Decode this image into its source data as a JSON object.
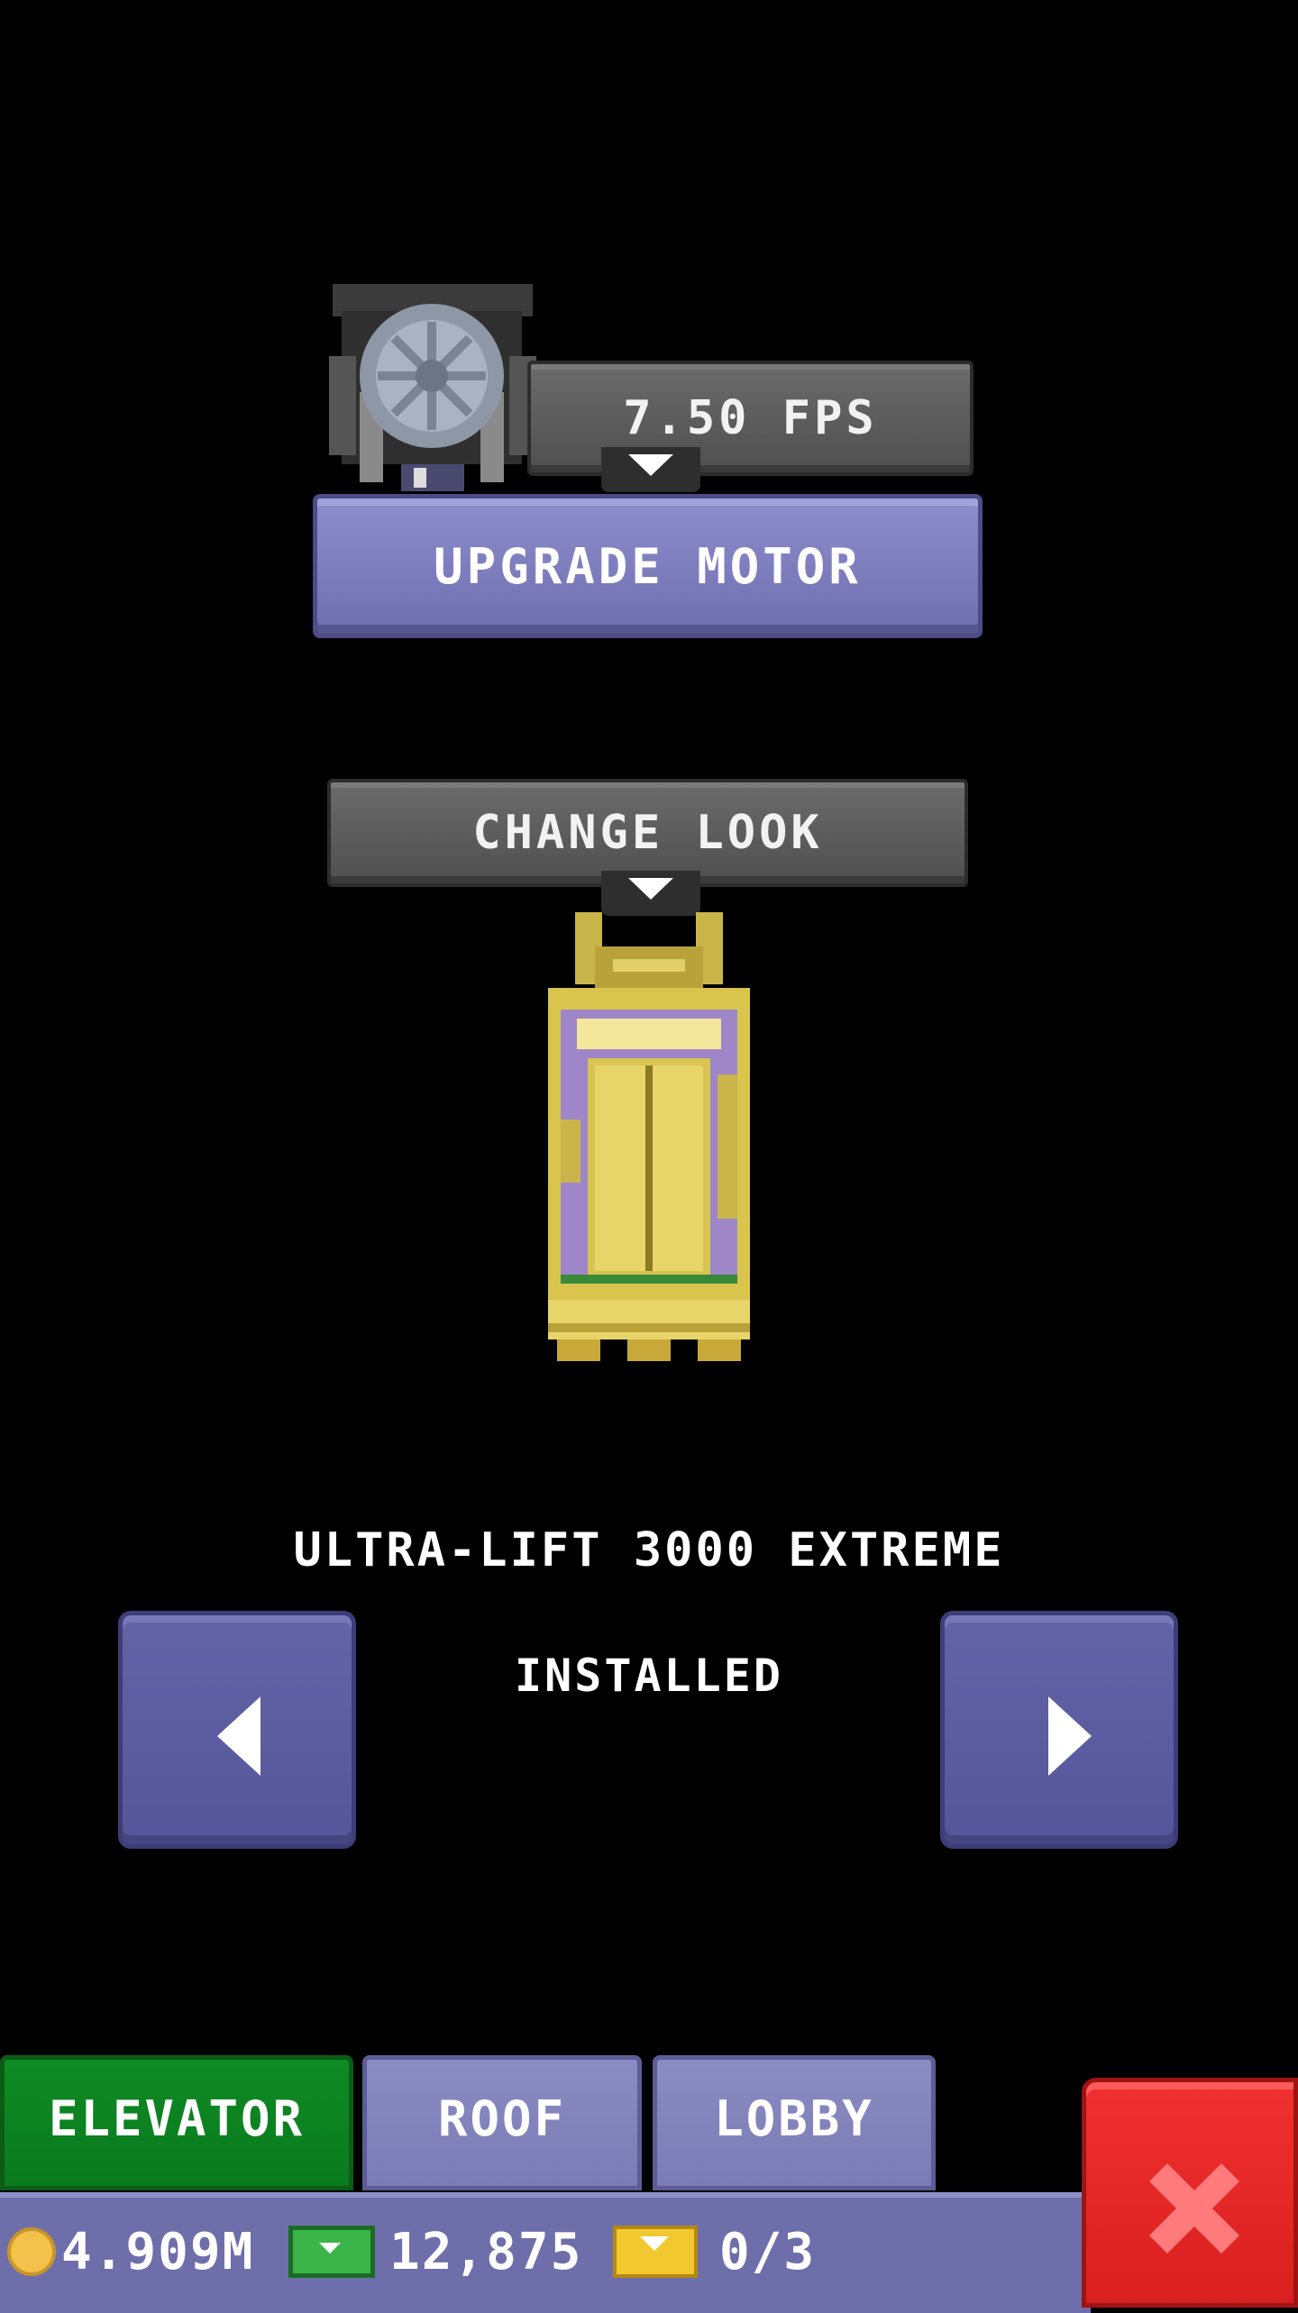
{
  "motor": {
    "speed": "7.50 FPS",
    "upgrade_label": "UPGRADE MOTOR"
  },
  "look": {
    "change_label": "CHANGE LOOK",
    "model_name": "ULTRA-LIFT 3000 EXTREME",
    "status": "INSTALLED"
  },
  "tabs": [
    {
      "label": "ELEVATOR",
      "active": true
    },
    {
      "label": "ROOF",
      "active": false
    },
    {
      "label": "LOBBY",
      "active": false
    }
  ],
  "status_bar": {
    "coins": "4.909M",
    "bux": "12,875",
    "chests": "0/3"
  },
  "colors": {
    "accent": "#7b7bb5",
    "active_tab": "#0f8a24",
    "close": "#e02424",
    "gold": "#e8d56a"
  }
}
